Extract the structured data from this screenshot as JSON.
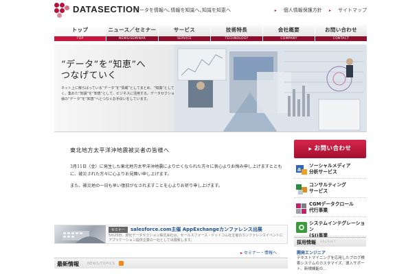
{
  "header": {
    "logo_text": "DATASECTION",
    "tagline": "データを情報へ､情報を知識へ､知識を知恵へ",
    "util_links": [
      "個人情報保護方針",
      "サイトマップ"
    ]
  },
  "nav": [
    {
      "label": "トップ",
      "sub": "TOP"
    },
    {
      "label": "ニュース／セミナー",
      "sub": "NEWS/SEMINAR"
    },
    {
      "label": "サービス",
      "sub": "SERVICE"
    },
    {
      "label": "技術特長",
      "sub": "TECHNOLOGY"
    },
    {
      "label": "会社概要",
      "sub": "COMPANY"
    },
    {
      "label": "お問い合わせ",
      "sub": "CONTACT"
    }
  ],
  "hero": {
    "headline_1": "“データ”を“知恵”へ",
    "headline_2": "つなげていく",
    "body": "ネット上に散らばっている“データ”を“情報”としてまとめ、“知識”として蓄えていく。集めた“知識”を“知恵”として、ビジネスに活用する。データセクションは、企業様の“データ”を“知恵”へとつなぐお手伝いをしています。"
  },
  "notice": {
    "title": "東北地方太平洋沖地震被災者の皆様へ",
    "para_1": "3月11日（金）に発生した東北地方太平洋沖地震により亡くなられた方々に衷心よりお悔み申し上げますとともに、被災された方々に心よりお見舞い申し上げます。",
    "para_2": "また、被災地の一日も早い復旧がなされますことを心よりお祈り申し上げます。"
  },
  "news": {
    "label": "セミナー",
    "title": "salesforce.com主催 AppExchangeカンファレンス出展",
    "desc": "5月25日、弊社データセクション株式会社は、セールスフォース・ドットコム社主催のカンファレンスイベントにアプリケーション提供企業の一社として出展致します。",
    "more_link": "セミナー・情報へ"
  },
  "latest": {
    "title": "最新情報",
    "sub": "NEWS/TOPICS"
  },
  "sidebar": {
    "contact": "お問い合わせ",
    "items": [
      {
        "line1": "ソーシャルメディア",
        "line2": "分析サービス"
      },
      {
        "line1": "コンサルティング",
        "line2": "サービス"
      },
      {
        "line1": "CGMデータクロール",
        "line2": "代行事業"
      },
      {
        "line1": "システムインテグレーション",
        "line2": "(SI)事業"
      }
    ],
    "recruit_title": "採用情報",
    "recruit_sub": "RECRUIT",
    "recruit_job": "開発エンジニア",
    "recruit_text": "テキストマイニングを応用したブログ検索システムのカスタマイズ、導入サポート、新規機能の…"
  },
  "colors": {
    "accent": "#b8123a",
    "nav_bar": "#8d0f2c",
    "link": "#1d4f91"
  }
}
